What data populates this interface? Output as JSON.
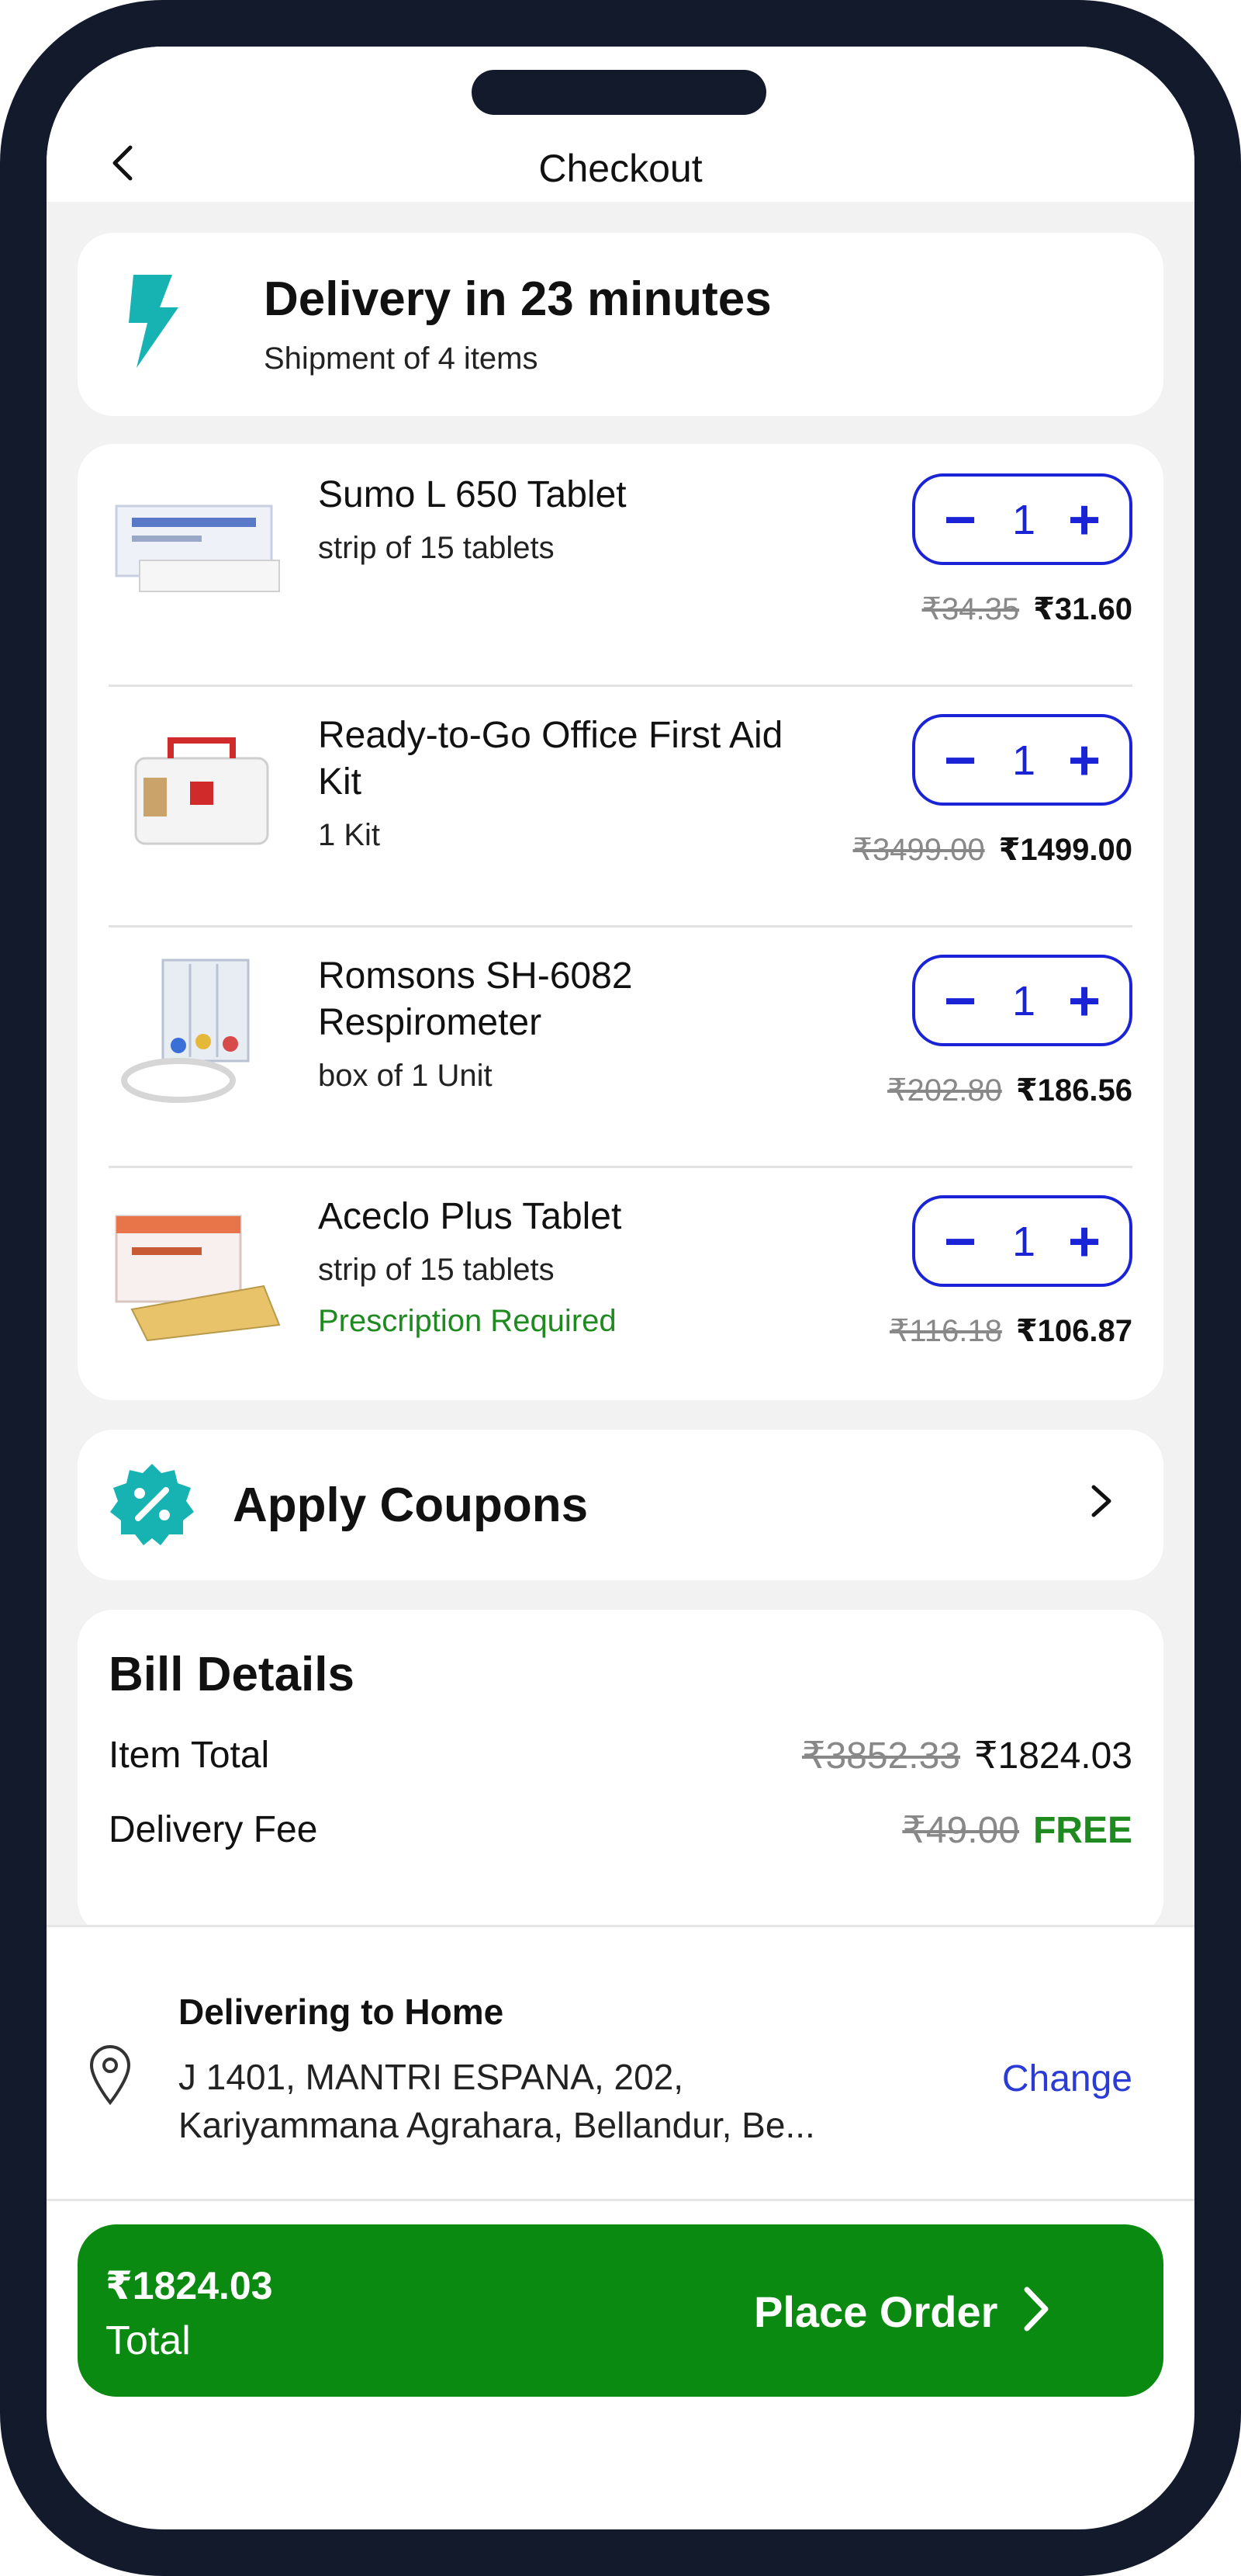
{
  "header": {
    "title": "Checkout",
    "back_icon": "chevron-left-icon"
  },
  "delivery": {
    "title": "Delivery in 23 minutes",
    "subtitle": "Shipment of 4 items",
    "icon": "lightning-bolt-icon",
    "icon_color": "#17b3b3"
  },
  "items": [
    {
      "name": "Sumo L 650 Tablet",
      "unit": "strip of 15 tablets",
      "qty": "1",
      "mrp": "₹34.35",
      "price": "₹31.60",
      "rx": ""
    },
    {
      "name": "Ready-to-Go Office First Aid Kit",
      "unit": "1 Kit",
      "qty": "1",
      "mrp": "₹3499.00",
      "price": "₹1499.00",
      "rx": ""
    },
    {
      "name": "Romsons SH-6082 Respirometer",
      "unit": "box of 1 Unit",
      "qty": "1",
      "mrp": "₹202.80",
      "price": "₹186.56",
      "rx": ""
    },
    {
      "name": "Aceclo Plus Tablet",
      "unit": "strip of 15 tablets",
      "qty": "1",
      "mrp": "₹116.18",
      "price": "₹106.87",
      "rx": "Prescription Required"
    }
  ],
  "coupons": {
    "label": "Apply Coupons",
    "icon": "discount-badge-icon"
  },
  "bill": {
    "title": "Bill Details",
    "item_total_label": "Item Total",
    "item_total_mrp": "₹3852.33",
    "item_total": "₹1824.03",
    "delivery_fee_label": "Delivery Fee",
    "delivery_fee_mrp": "₹49.00",
    "delivery_fee": "FREE"
  },
  "address": {
    "title": "Delivering to Home",
    "line1": "J 1401, MANTRI ESPANA, 202,",
    "line2": "Kariyammana Agrahara, Bellandur, Be...",
    "change_label": "Change"
  },
  "footer": {
    "total_amount": "₹1824.03",
    "total_label": "Total",
    "place_order_label": "Place Order"
  },
  "colors": {
    "accent_blue": "#1a24d6",
    "brand_green": "#0b8a12",
    "teal": "#17b3b3"
  }
}
